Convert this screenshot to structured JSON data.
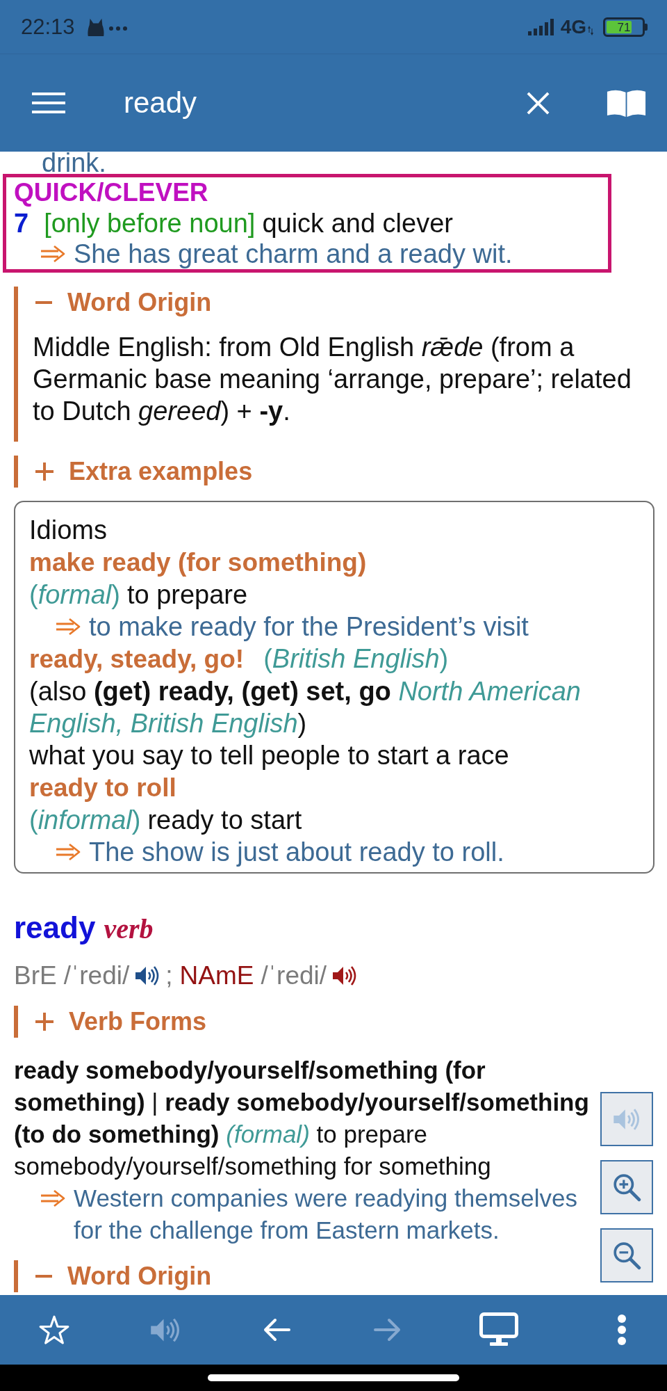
{
  "status_bar": {
    "time": "22:13",
    "network": "4G",
    "battery": "71"
  },
  "toolbar": {
    "search": {
      "value": "ready"
    }
  },
  "entries": [
    {
      "blocks": [
        {
          "kind": "fragment",
          "text": "drink."
        },
        {
          "kind": "sense",
          "highlighted": true,
          "signpost": "QUICK/CLEVER",
          "number": "7",
          "grammar": "[only before noun]",
          "definition": "quick and clever",
          "examples": [
            "She has great charm and a ready wit."
          ]
        },
        {
          "kind": "section",
          "title": "Word Origin",
          "expanded": true,
          "text": "Middle English: from Old English *rǣde* (from a Germanic base meaning ‘arrange, prepare’; related to Dutch *gereed*) + **-y**."
        },
        {
          "kind": "section",
          "title": "Extra examples",
          "expanded": false
        },
        {
          "kind": "idioms",
          "title": "Idioms",
          "items": [
            {
              "phrase": "make ready (for something)",
              "register": "(*formal*)",
              "definition": "to prepare",
              "examples": [
                "to make ready for the President’s visit"
              ]
            },
            {
              "phrase": "ready, steady, go!",
              "phrase_register": "(*British English*)",
              "also": "(also **(get) ready, (get) set, go** *North American English, British English*)",
              "definition": "what you say to tell people to start a race"
            },
            {
              "phrase": "ready to roll",
              "register": "(*informal*)",
              "definition": "ready to start",
              "examples": [
                "The show is just about ready to roll."
              ]
            }
          ]
        }
      ]
    },
    {
      "headword": "ready",
      "part_of_speech": "verb",
      "pronunciations": [
        {
          "label": "BrE",
          "ipa": "/ˈredi/",
          "color": "#1f4f8a"
        },
        {
          "label": "NAmE",
          "ipa": "/ˈredi/",
          "color": "#a01818"
        }
      ],
      "pron_separator": ";",
      "blocks": [
        {
          "kind": "section",
          "title": "Verb Forms",
          "expanded": false
        },
        {
          "kind": "sense",
          "definition": "**ready somebody/yourself/something (for something)** | **ready somebody/yourself/something (to do something)** *(formal)* to prepare somebody/yourself/something for something",
          "examples": [
            "Western companies were readying themselves for the challenge from Eastern markets."
          ]
        },
        {
          "kind": "section",
          "title": "Word Origin",
          "expanded": true
        }
      ]
    }
  ],
  "floating_controls": [
    {
      "kind": "speak",
      "disabled": true
    },
    {
      "kind": "zoom_in",
      "disabled": false
    },
    {
      "kind": "zoom_out",
      "disabled": false
    }
  ],
  "bottom_bar": [
    {
      "kind": "favorite",
      "disabled": false
    },
    {
      "kind": "speak",
      "disabled": true
    },
    {
      "kind": "back",
      "disabled": false
    },
    {
      "kind": "forward",
      "disabled": true
    },
    {
      "kind": "display",
      "disabled": false
    },
    {
      "kind": "more",
      "disabled": false
    }
  ]
}
